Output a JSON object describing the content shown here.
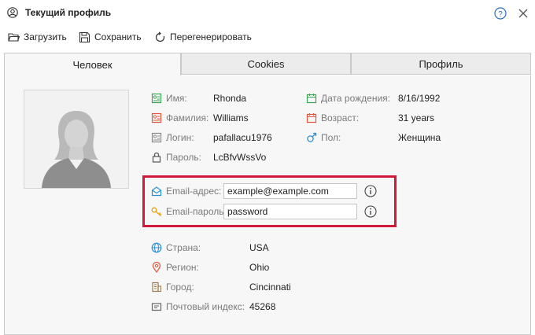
{
  "window": {
    "title": "Текущий профиль"
  },
  "toolbar": {
    "load": "Загрузить",
    "save": "Сохранить",
    "regenerate": "Перегенерировать"
  },
  "tabs": [
    {
      "label": "Человек",
      "active": true
    },
    {
      "label": "Cookies",
      "active": false
    },
    {
      "label": "Профиль",
      "active": false
    }
  ],
  "person": {
    "first_name": {
      "label": "Имя:",
      "value": "Rhonda"
    },
    "last_name": {
      "label": "Фамилия:",
      "value": "Williams"
    },
    "login": {
      "label": "Логин:",
      "value": "pafallacu1976"
    },
    "password": {
      "label": "Пароль:",
      "value": "LcBfvWssVo"
    },
    "birth_date": {
      "label": "Дата рождения:",
      "value": "8/16/1992"
    },
    "age": {
      "label": "Возраст:",
      "value": "31 years"
    },
    "gender": {
      "label": "Пол:",
      "value": "Женщина"
    }
  },
  "email": {
    "address": {
      "label": "Email-адрес:",
      "value": "example@example.com"
    },
    "password": {
      "label": "Email-пароль:",
      "value": "password"
    }
  },
  "address": {
    "country": {
      "label": "Страна:",
      "value": "USA"
    },
    "region": {
      "label": "Регион:",
      "value": "Ohio"
    },
    "city": {
      "label": "Город:",
      "value": "Cincinnati"
    },
    "zip": {
      "label": "Почтовый индекс:",
      "value": "45268"
    }
  },
  "colors": {
    "highlight": "#d11a3a",
    "green_icon": "#3aa655",
    "red_icon": "#e0563b",
    "blue_icon": "#2b8fd6"
  }
}
